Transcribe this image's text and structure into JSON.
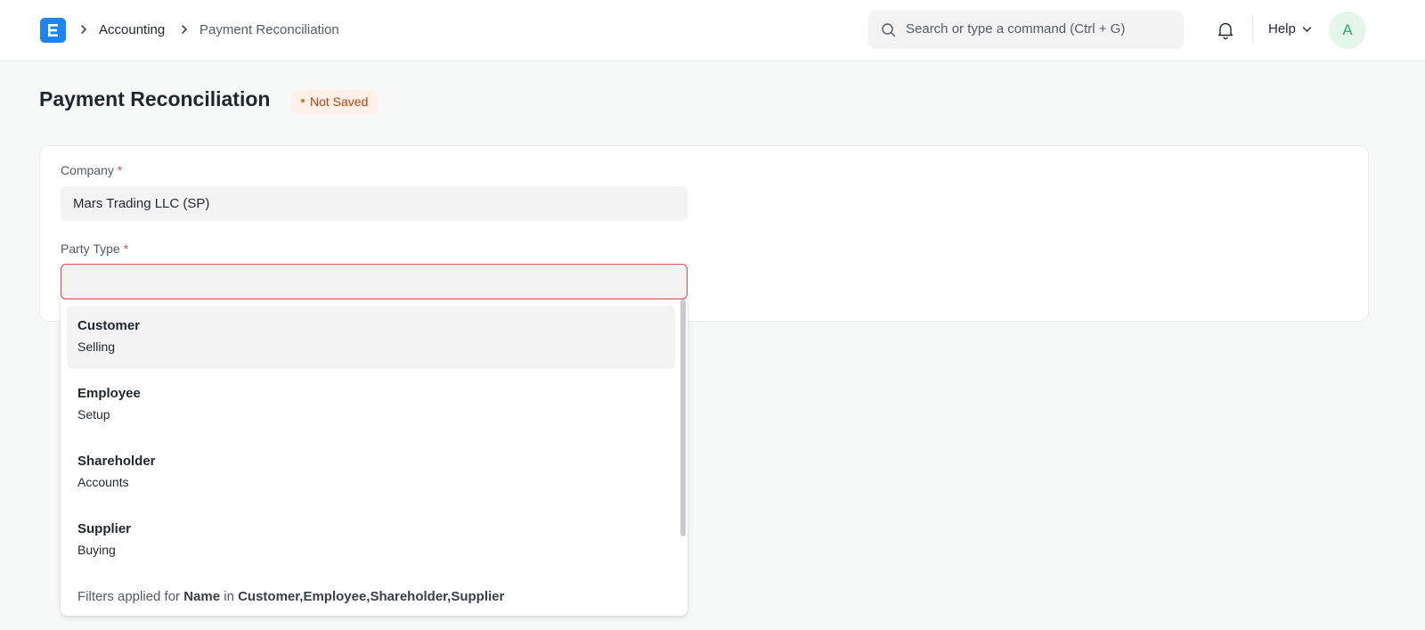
{
  "navbar": {
    "breadcrumbs": [
      "Accounting",
      "Payment Reconciliation"
    ],
    "search_placeholder": "Search or type a command (Ctrl + G)",
    "help_label": "Help",
    "avatar_initial": "A"
  },
  "page": {
    "title": "Payment Reconciliation",
    "status": "Not Saved"
  },
  "form": {
    "company": {
      "label": "Company",
      "required_mark": "*",
      "value": "Mars Trading LLC (SP)"
    },
    "party_type": {
      "label": "Party Type",
      "required_mark": "*",
      "value": ""
    }
  },
  "dropdown": {
    "options": [
      {
        "title": "Customer",
        "subtitle": "Selling"
      },
      {
        "title": "Employee",
        "subtitle": "Setup"
      },
      {
        "title": "Shareholder",
        "subtitle": "Accounts"
      },
      {
        "title": "Supplier",
        "subtitle": "Buying"
      }
    ],
    "footer": {
      "prefix": "Filters applied for ",
      "field": "Name",
      "middle": " in ",
      "values": "Customer,Employee,Shareholder,Supplier"
    }
  },
  "colors": {
    "brand": "#1c85f5",
    "error_border": "#e24c4c",
    "status_text": "#bd3e0c"
  }
}
